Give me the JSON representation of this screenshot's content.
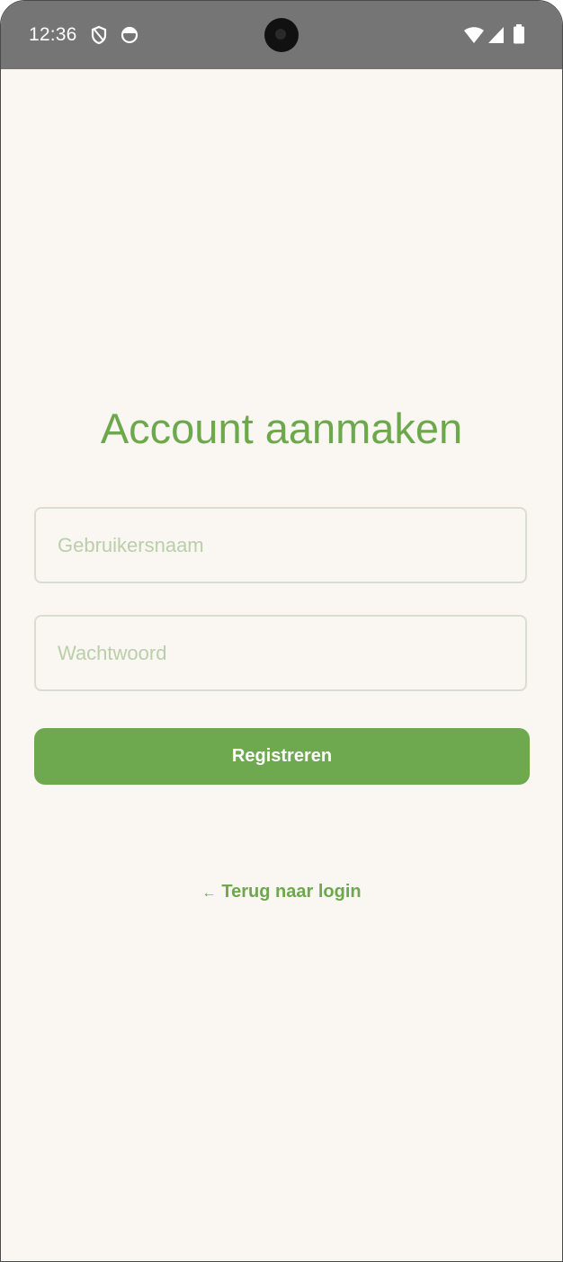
{
  "status_bar": {
    "time": "12:36",
    "left_icons": [
      "shield-icon",
      "sync-circle-icon"
    ],
    "right_icons": [
      "wifi-icon",
      "cell-signal-icon",
      "battery-icon"
    ]
  },
  "screen": {
    "title": "Account aanmaken",
    "username_field": {
      "placeholder": "Gebruikersnaam",
      "value": ""
    },
    "password_field": {
      "placeholder": "Wachtwoord",
      "value": ""
    },
    "register_button": "Registreren",
    "back_link": {
      "arrow": "←",
      "label": "Terug naar login"
    }
  },
  "colors": {
    "accent": "#6ea84d",
    "background": "#faf6f2",
    "status_bar": "#757575",
    "field_border": "#d9ddd2",
    "placeholder": "#b9cfa9"
  }
}
